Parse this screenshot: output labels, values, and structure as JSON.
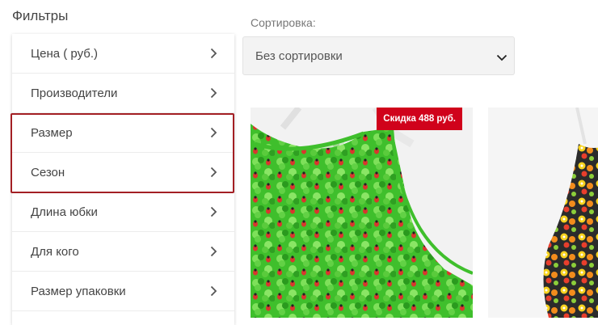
{
  "filters": {
    "title": "Фильтры",
    "items": [
      {
        "label": "Цена ( руб.)"
      },
      {
        "label": "Производители"
      },
      {
        "label": "Размер"
      },
      {
        "label": "Сезон"
      },
      {
        "label": "Длина юбки"
      },
      {
        "label": "Для кого"
      },
      {
        "label": "Размер упаковки"
      }
    ],
    "chevron_icon": "chevron-right-icon"
  },
  "sort": {
    "label": "Сортировка:",
    "value": "Без сортировки",
    "chevron_icon": "chevron-down-icon"
  },
  "products": [
    {
      "badge": "Скидка 488 руб.",
      "image": "green sleeveless dress with clover and ladybug print"
    },
    {
      "image": "sleeveless dress with colorful fruit print"
    }
  ],
  "colors": {
    "badge": "#d0021b",
    "highlight": "#a31f24",
    "dress_green": "#3fbf2c"
  }
}
